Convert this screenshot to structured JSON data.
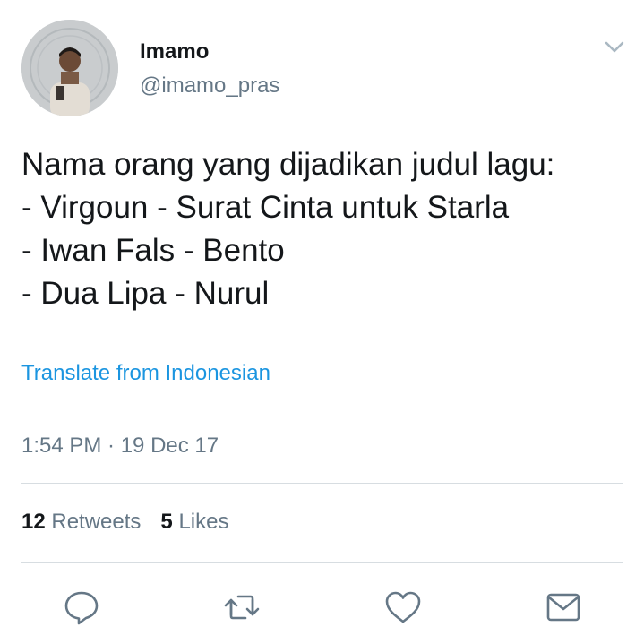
{
  "user": {
    "display_name": "Imamo",
    "handle": "@imamo_pras"
  },
  "tweet": {
    "lines": [
      "Nama orang yang dijadikan judul lagu:",
      "- Virgoun - Surat Cinta untuk Starla",
      "- Iwan Fals - Bento",
      "- Dua Lipa - Nurul"
    ],
    "translate_label": "Translate from Indonesian",
    "timestamp": "1:54 PM · 19 Dec 17"
  },
  "stats": {
    "retweets_count": "12",
    "retweets_label": "Retweets",
    "likes_count": "5",
    "likes_label": "Likes"
  },
  "icons": {
    "caret": "chevron-down-icon",
    "reply": "reply-icon",
    "retweet": "retweet-icon",
    "like": "heart-icon",
    "message": "envelope-icon"
  },
  "colors": {
    "link": "#1b95e0",
    "secondary_text": "#657786",
    "primary_text": "#14171a",
    "divider": "#d7dde1"
  }
}
